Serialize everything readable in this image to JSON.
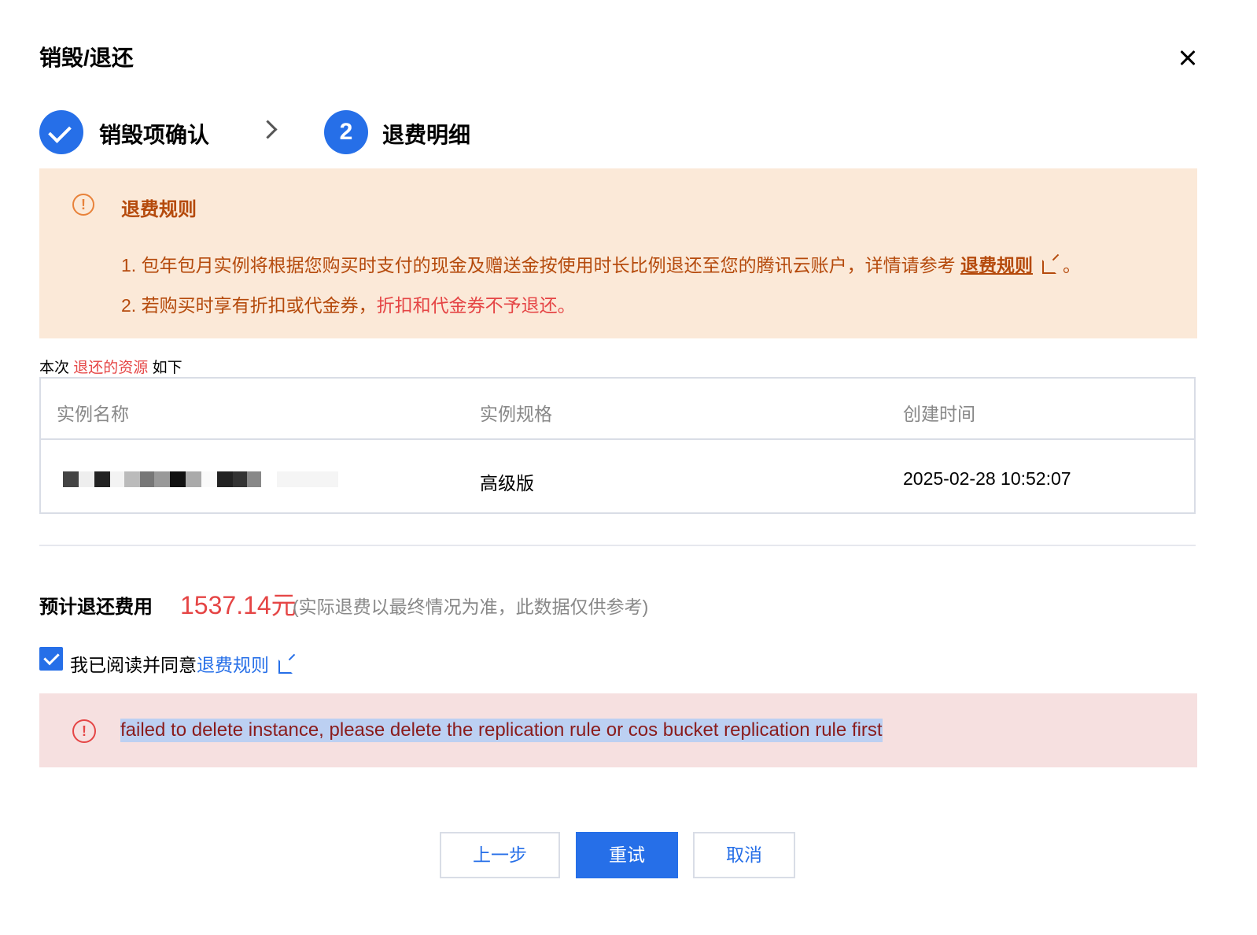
{
  "dialog": {
    "title": "销毁/退还"
  },
  "steps": [
    {
      "label": "销毁项确认",
      "status": "done"
    },
    {
      "number": "2",
      "label": "退费明细",
      "status": "active"
    }
  ],
  "rules": {
    "icon_text": "!",
    "title": "退费规则",
    "line1_prefix": "1. 包年包月实例将根据您购买时支付的现金及赠送金按使用时长比例退还至您的腾讯云账户，详情请参考",
    "line1_link": "退费规则",
    "line1_suffix": "。",
    "line2_prefix": "2. 若购买时享有折扣或代金券，",
    "line2_highlight": "折扣和代金券不予退还。"
  },
  "resources": {
    "caption_prefix": "本次",
    "caption_highlight": "退还的资源",
    "caption_suffix": "如下",
    "columns": [
      "实例名称",
      "实例规格",
      "创建时间"
    ],
    "rows": [
      {
        "spec": "高级版",
        "created": "2025-02-28 10:52:07"
      }
    ]
  },
  "fee": {
    "label": "预计退还费用",
    "amount": "1537.14元",
    "note": "(实际退费以最终情况为准，此数据仅供参考)"
  },
  "agreement": {
    "checked": true,
    "text": "我已阅读并同意",
    "link": "退费规则"
  },
  "error": {
    "icon_text": "!",
    "message": "failed to delete instance, please delete the replication rule or cos bucket replication rule first"
  },
  "buttons": {
    "prev": "上一步",
    "retry": "重试",
    "cancel": "取消"
  },
  "colors": {
    "primary": "#266fe8",
    "warning_bg": "#fbe9d8",
    "warning_text": "#b54a0c",
    "danger": "#e54545",
    "error_bg": "#f6e0e0"
  }
}
